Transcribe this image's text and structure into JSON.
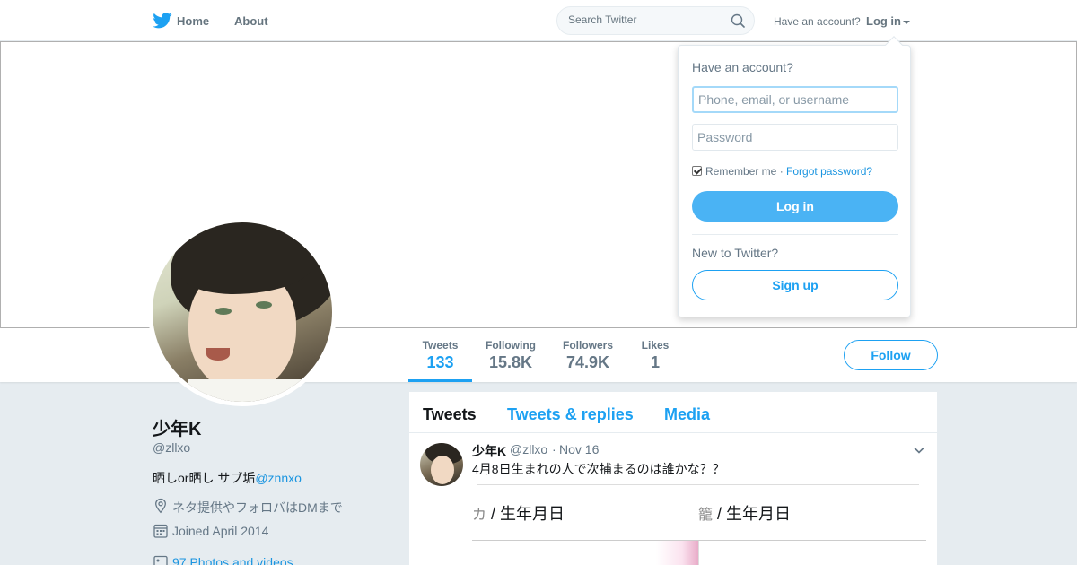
{
  "nav": {
    "home_label": "Home",
    "about_label": "About",
    "search_placeholder": "Search Twitter",
    "have_account": "Have an account?",
    "login_label": "Log in"
  },
  "stats": {
    "tweets_label": "Tweets",
    "tweets_value": "133",
    "following_label": "Following",
    "following_value": "15.8K",
    "followers_label": "Followers",
    "followers_value": "74.9K",
    "likes_label": "Likes",
    "likes_value": "1",
    "follow_button": "Follow"
  },
  "profile": {
    "name": "少年K",
    "handle": "@zllxo",
    "bio_text": "晒しor晒し サブ垢",
    "bio_link": "@znnxo",
    "location": "ネタ提供やフォロバはDMまで",
    "joined": "Joined April 2014",
    "photos": "97 Photos and videos"
  },
  "timeline": {
    "tabs": [
      "Tweets",
      "Tweets & replies",
      "Media"
    ],
    "tweet": {
      "name": "少年K",
      "handle": "@zllxo",
      "separator": "·",
      "time": "Nov 16",
      "text": "4月8日生まれの人で次捕まるのは誰かな？？",
      "media_left_faded": "カ",
      "media_left": "/ 生年月日",
      "media_right_faded": "籠",
      "media_right": "/ 生年月日"
    }
  },
  "login_dropdown": {
    "title": "Have an account?",
    "username_placeholder": "Phone, email, or username",
    "password_placeholder": "Password",
    "remember_label": "Remember me",
    "separator": "·",
    "forgot_label": "Forgot password?",
    "login_button": "Log in",
    "new_label": "New to Twitter?",
    "signup_button": "Sign up"
  },
  "colors": {
    "accent": "#1da1f2",
    "background": "#e6ecf0",
    "text_primary": "#14171a",
    "text_secondary": "#657786"
  },
  "icons": [
    "twitter-bird-icon",
    "search-icon",
    "caret-down-icon",
    "location-icon",
    "calendar-icon",
    "photos-icon",
    "chevron-down-icon",
    "checkbox-icon"
  ]
}
